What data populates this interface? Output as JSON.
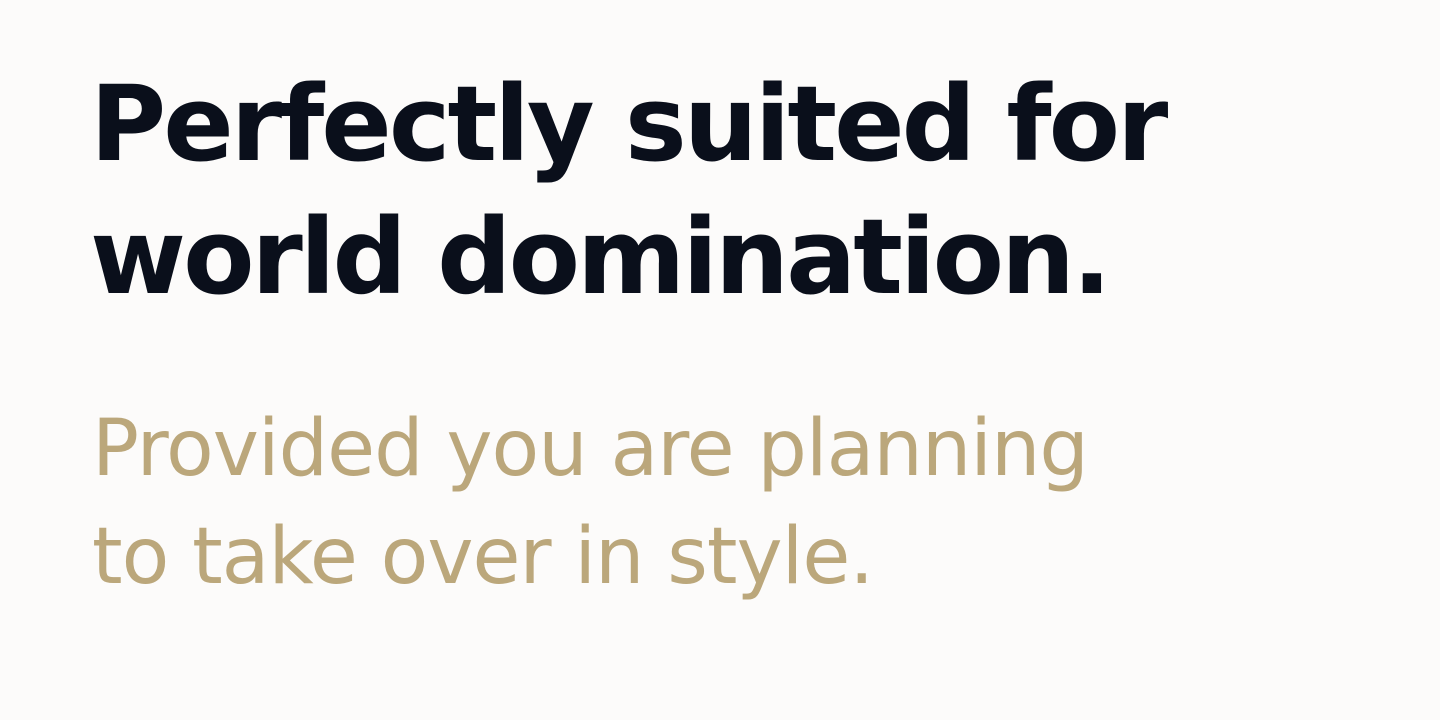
{
  "hero": {
    "headline": {
      "line1": "Perfectly suited for",
      "line2": "world domination."
    },
    "subhead": {
      "line1": "Provided you are planning",
      "line2": "to take over in style."
    }
  },
  "colors": {
    "background": "#fcfbfa",
    "headline": "#0a0f1b",
    "subhead": "#bba77b"
  }
}
